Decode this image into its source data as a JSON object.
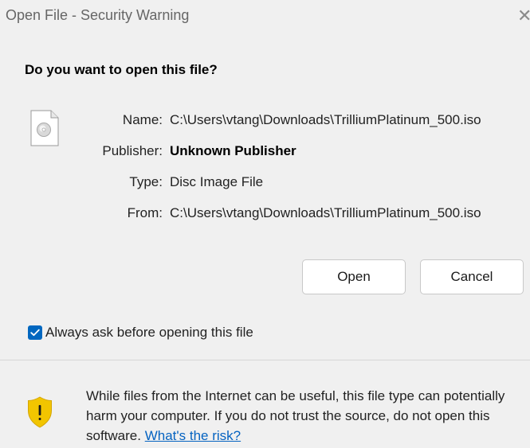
{
  "window": {
    "title": "Open File - Security Warning",
    "close_glyph": "✕"
  },
  "dialog": {
    "heading": "Do you want to open this file?",
    "file_icon": "disc-image-file-icon",
    "fields": [
      {
        "label": "Name:",
        "value": "C:\\Users\\vtang\\Downloads\\TrilliumPlatinum_500.iso"
      },
      {
        "label": "Publisher:",
        "value": "Unknown Publisher"
      },
      {
        "label": "Type:",
        "value": "Disc Image File"
      },
      {
        "label": "From:",
        "value": "C:\\Users\\vtang\\Downloads\\TrilliumPlatinum_500.iso"
      }
    ],
    "buttons": {
      "open_label": "Open",
      "cancel_label": "Cancel"
    },
    "checkbox": {
      "label": "Always ask before opening this file",
      "checked": true
    },
    "warning": {
      "icon": "shield-warning-icon",
      "text": "While files from the Internet can be useful, this file type can potentially harm your computer. If you do not trust the source, do not open this software. ",
      "link_label": "What's the risk?"
    }
  },
  "colors": {
    "accent": "#0067c0",
    "link": "#0563c1",
    "shield": "#f2c500"
  }
}
